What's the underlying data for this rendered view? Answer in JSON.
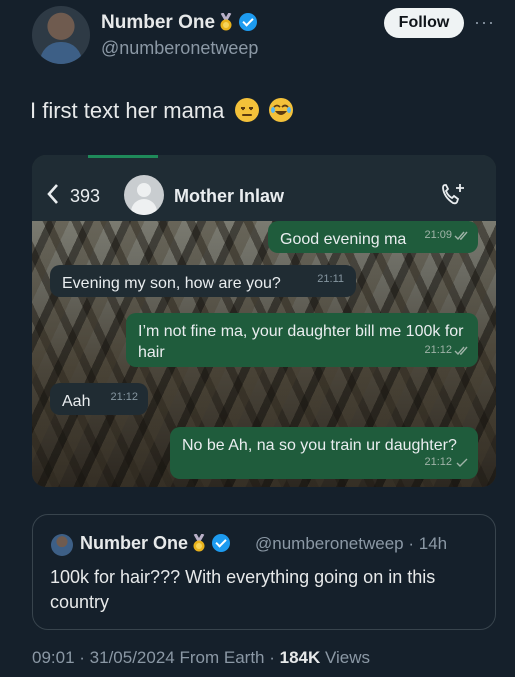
{
  "tweet": {
    "author_name": "Number One",
    "author_handle": "@numberonetweep",
    "follow_label": "Follow",
    "more_label": "···",
    "text": "I first text her mama",
    "emoji_1": "😒",
    "emoji_2": "😂"
  },
  "media": {
    "back_count": "393",
    "contact_name": "Mother Inlaw",
    "messages": [
      {
        "text": "Good evening ma",
        "time": "21:09",
        "status": "read"
      },
      {
        "text": "Evening my son, how are you?",
        "time": "21:11",
        "status": ""
      },
      {
        "text": "I’m not fine ma, your daughter bill me 100k for hair",
        "time": "21:12",
        "status": "read"
      },
      {
        "text": "Aah",
        "time": "21:12",
        "status": ""
      },
      {
        "text": "No be Ah, na so you train ur daughter?",
        "time": "21:12",
        "status": "sent"
      }
    ]
  },
  "quote": {
    "author_name": "Number One",
    "author_handle": "@numberonetweep",
    "age": "· 14h",
    "text": "100k for hair??? With everything going on in this country"
  },
  "meta": {
    "time": "09:01",
    "date": "31/05/2024",
    "source": "From Earth",
    "views_count": "184K",
    "views_label": "Views"
  },
  "colors": {
    "background": "#15202b",
    "accent": "#1d9bf0",
    "bubble_out": "#1f5c3c",
    "bubble_in": "#202c33"
  }
}
